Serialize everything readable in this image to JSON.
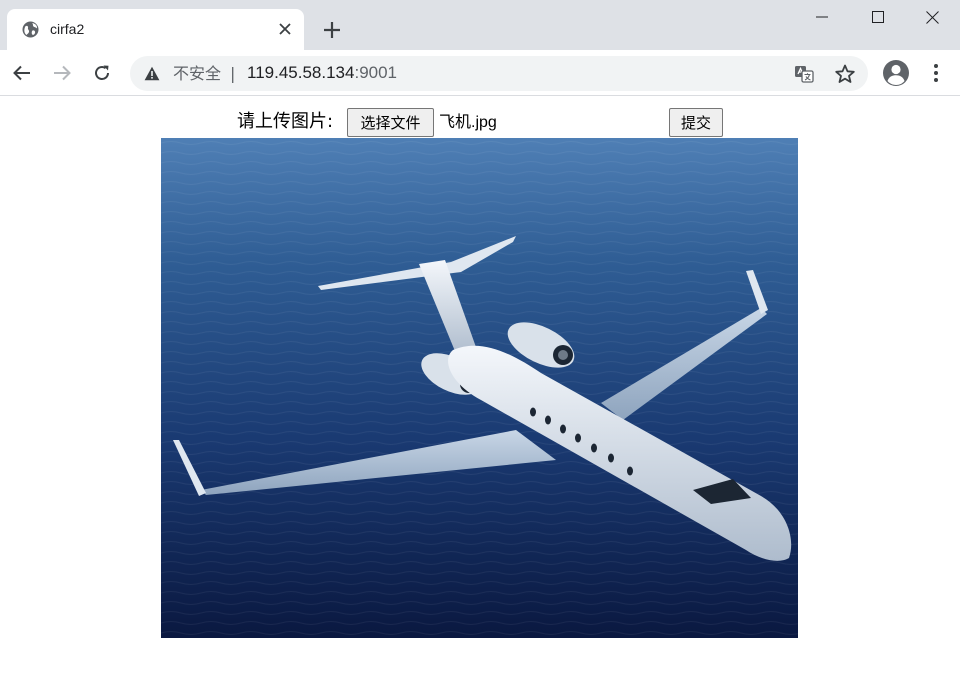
{
  "browser": {
    "tab": {
      "title": "cirfa2"
    },
    "address_bar": {
      "security_label": "不安全",
      "separator": "|",
      "host": "119.45.58.134",
      "port": ":9001"
    }
  },
  "page": {
    "upload_label": "请上传图片:",
    "choose_file_label": "选择文件",
    "selected_file": "飞机.jpg",
    "submit_label": "提交"
  },
  "colors": {
    "tabstrip_bg": "#dee1e6",
    "omnibox_bg": "#f1f3f4",
    "icon_gray": "#5f6368",
    "sea_deep": "#0d1f4a",
    "sea_light": "#3f6ea5",
    "aircraft_body": "#e9eef4"
  },
  "icons": {
    "favicon": "globe-icon",
    "close": "close-icon",
    "new_tab": "plus-icon",
    "back": "arrow-left-icon",
    "forward": "arrow-right-icon",
    "reload": "reload-icon",
    "security": "warning-icon",
    "translate": "translate-icon",
    "bookmark": "star-icon",
    "profile": "account-icon",
    "menu": "kebab-menu-icon"
  }
}
